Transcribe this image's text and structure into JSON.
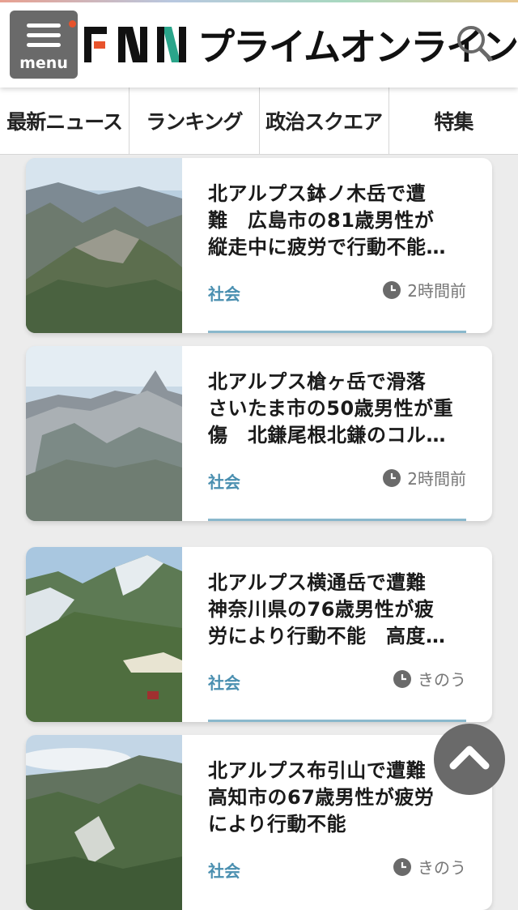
{
  "header": {
    "menu_label": "menu",
    "logo_text": "FNN",
    "logo_sub": "プライムオンライン",
    "icons": {
      "menu": "hamburger-icon",
      "search": "search-icon"
    },
    "colors": {
      "menu_bg": "#6a6a6a",
      "notify_dot": "#e8532c",
      "logo_f": "#e8532c",
      "logo_n2": "#2aa58a"
    }
  },
  "tabs": [
    "最新ニュース",
    "ランキング",
    "政治スクエア",
    "特集"
  ],
  "articles": [
    {
      "title_lines": [
        "北アルプス鉢ノ木岳で遭",
        "難　広島市の81歳男性が",
        "縦走中に疲労で行動不能…"
      ],
      "category": "社会",
      "time": "2時間前"
    },
    {
      "title_lines": [
        "北アルプス槍ヶ岳で滑落",
        "さいたま市の50歳男性が重",
        "傷　北鎌尾根北鎌のコル…"
      ],
      "category": "社会",
      "time": "2時間前"
    },
    {
      "title_lines": [
        "北アルプス横通岳で遭難",
        "神奈川県の76歳男性が疲",
        "労により行動不能　高度…"
      ],
      "category": "社会",
      "time": "きのう"
    },
    {
      "title_lines": [
        "北アルプス布引山で遭難",
        "高知市の67歳男性が疲労",
        "により行動不能"
      ],
      "category": "社会",
      "time": "きのう"
    }
  ],
  "scroll_top_icon": "chevron-up-icon",
  "accent_color": "#4a8fb0"
}
